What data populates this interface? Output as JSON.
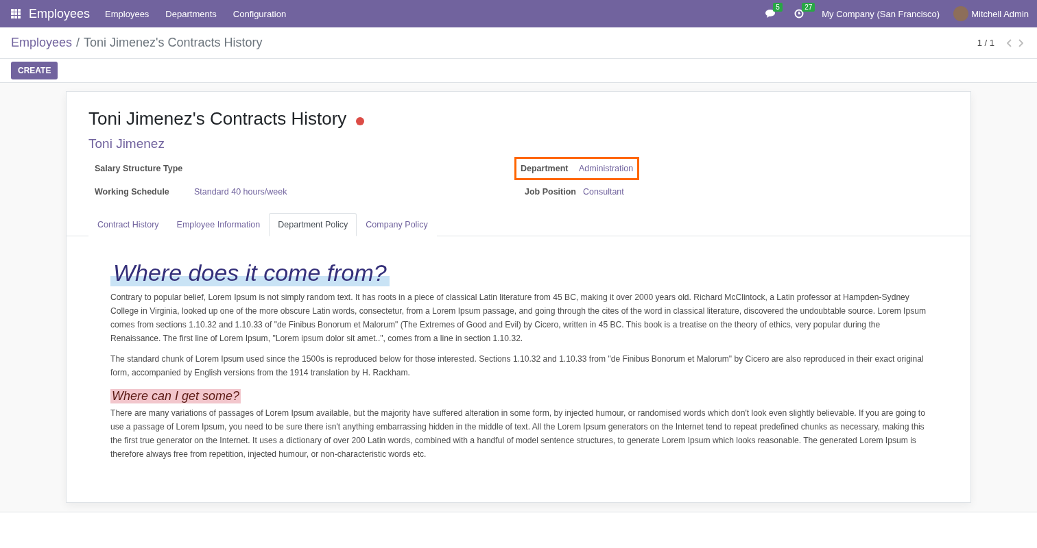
{
  "navbar": {
    "app_name": "Employees",
    "menu": [
      "Employees",
      "Departments",
      "Configuration"
    ],
    "messages_count": "5",
    "activities_count": "27",
    "company": "My Company (San Francisco)",
    "user": "Mitchell Admin"
  },
  "breadcrumb": {
    "parent": "Employees",
    "separator": "/",
    "current": "Toni Jimenez's Contracts History"
  },
  "pager": "1 / 1",
  "create_button": "CREATE",
  "form": {
    "title": "Toni Jimenez's Contracts History",
    "status_dot": {
      "color": "#dc4c46"
    },
    "employee": "Toni Jimenez",
    "left_fields": [
      {
        "label": "Salary Structure Type"
      },
      {
        "label": "Working Schedule",
        "value": "Standard 40 hours/week"
      }
    ],
    "right_fields": [
      {
        "label": "Department",
        "value": "Administration",
        "highlighted": true
      },
      {
        "label": "Job Position",
        "value": "Consultant",
        "highlighted": false
      }
    ],
    "tabs": [
      {
        "label": "Contract History",
        "selected": false
      },
      {
        "label": "Employee Information",
        "selected": false
      },
      {
        "label": "Department Policy",
        "selected": true
      },
      {
        "label": "Company Policy",
        "selected": false
      }
    ],
    "content": [
      {
        "kind": "h1",
        "text": "Where does it come from?"
      },
      {
        "kind": "p",
        "text": "Contrary to popular belief, Lorem Ipsum is not simply random text. It has roots in a piece of classical Latin literature from 45 BC, making it over 2000 years old. Richard McClintock, a Latin professor at Hampden-Sydney College in Virginia, looked up one of the more obscure Latin words, consectetur, from a Lorem Ipsum passage, and going through the cites of the word in classical literature, discovered the undoubtable source. Lorem Ipsum comes from sections 1.10.32 and 1.10.33 of \"de Finibus Bonorum et Malorum\" (The Extremes of Good and Evil) by Cicero, written in 45 BC. This book is a treatise on the theory of ethics, very popular during the Renaissance. The first line of Lorem Ipsum, \"Lorem ipsum dolor sit amet..\", comes from a line in section 1.10.32."
      },
      {
        "kind": "p",
        "text": "The standard chunk of Lorem Ipsum used since the 1500s is reproduced below for those interested. Sections 1.10.32 and 1.10.33 from \"de Finibus Bonorum et Malorum\" by Cicero are also reproduced in their exact original form, accompanied by English versions from the 1914 translation by H. Rackham."
      },
      {
        "kind": "h2",
        "text": "Where can I get some?"
      },
      {
        "kind": "p",
        "text": "There are many variations of passages of Lorem Ipsum available, but the majority have suffered alteration in some form, by injected humour, or randomised words which don't look even slightly believable. If you are going to use a passage of Lorem Ipsum, you need to be sure there isn't anything embarrassing hidden in the middle of text. All the Lorem Ipsum generators on the Internet tend to repeat predefined chunks as necessary, making this the first true generator on the Internet. It uses a dictionary of over 200 Latin words, combined with a handful of model sentence structures, to generate Lorem Ipsum which looks reasonable. The generated Lorem Ipsum is therefore always free from repetition, injected humour, or non-characteristic words etc."
      }
    ]
  }
}
